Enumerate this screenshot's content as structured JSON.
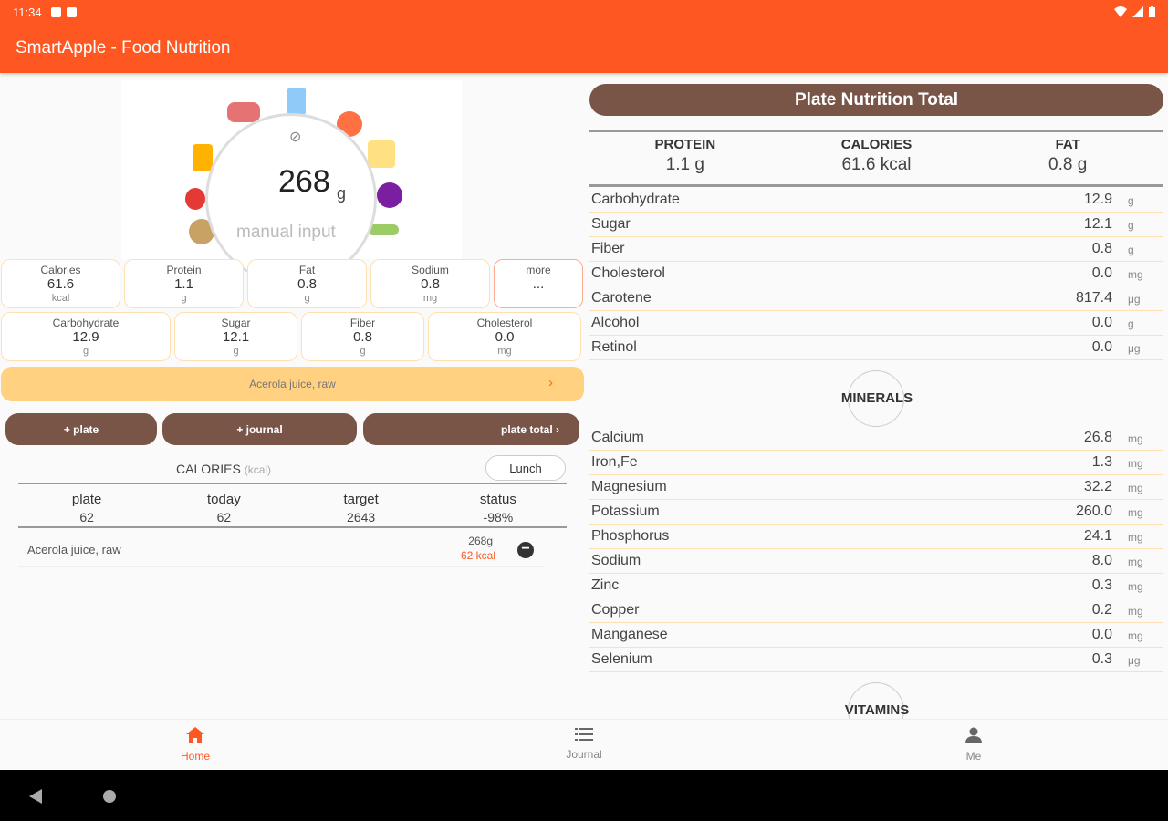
{
  "status_bar": {
    "time": "11:34"
  },
  "app": {
    "title": "SmartApple - Food Nutrition"
  },
  "plate": {
    "weight": "268",
    "weight_unit": "g",
    "manual_label": "manual input",
    "link_icon": "link-off-icon"
  },
  "nutrients_row1": [
    {
      "label": "Calories",
      "value": "61.6",
      "unit": "kcal"
    },
    {
      "label": "Protein",
      "value": "1.1",
      "unit": "g"
    },
    {
      "label": "Fat",
      "value": "0.8",
      "unit": "g"
    },
    {
      "label": "Sodium",
      "value": "0.8",
      "unit": "mg"
    },
    {
      "label": "more",
      "value": "...",
      "unit": ""
    }
  ],
  "nutrients_row2": [
    {
      "label": "Carbohydrate",
      "value": "12.9",
      "unit": "g"
    },
    {
      "label": "Sugar",
      "value": "12.1",
      "unit": "g"
    },
    {
      "label": "Fiber",
      "value": "0.8",
      "unit": "g"
    },
    {
      "label": "Cholesterol",
      "value": "0.0",
      "unit": "mg"
    }
  ],
  "food_bar": {
    "name": "Acerola juice, raw",
    "arrow": "›"
  },
  "actions": {
    "plate": "+ plate",
    "journal": "+ journal",
    "plate_total": "plate total ›"
  },
  "calories": {
    "title": "CALORIES",
    "unit": "(kcal)",
    "meal": "Lunch",
    "columns": [
      {
        "header": "plate",
        "value": "62"
      },
      {
        "header": "today",
        "value": "62"
      },
      {
        "header": "target",
        "value": "2643"
      },
      {
        "header": "status",
        "value": "-98%"
      }
    ],
    "entries": [
      {
        "name": "Acerola juice, raw",
        "weight": "268g",
        "kcal": "62 kcal"
      }
    ]
  },
  "plate_total": {
    "title": "Plate Nutrition Total",
    "macros": [
      {
        "label": "PROTEIN",
        "value": "1.1 g"
      },
      {
        "label": "CALORIES",
        "value": "61.6 kcal"
      },
      {
        "label": "FAT",
        "value": "0.8 g"
      }
    ],
    "nutrients": [
      {
        "label": "Carbohydrate",
        "value": "12.9",
        "unit": "g"
      },
      {
        "label": "Sugar",
        "value": "12.1",
        "unit": "g"
      },
      {
        "label": "Fiber",
        "value": "0.8",
        "unit": "g"
      },
      {
        "label": "Cholesterol",
        "value": "0.0",
        "unit": "mg"
      },
      {
        "label": "Carotene",
        "value": "817.4",
        "unit": "μg"
      },
      {
        "label": "Alcohol",
        "value": "0.0",
        "unit": "g"
      },
      {
        "label": "Retinol",
        "value": "0.0",
        "unit": "μg"
      }
    ],
    "minerals_title": "MINERALS",
    "minerals": [
      {
        "label": "Calcium",
        "value": "26.8",
        "unit": "mg"
      },
      {
        "label": "Iron,Fe",
        "value": "1.3",
        "unit": "mg"
      },
      {
        "label": "Magnesium",
        "value": "32.2",
        "unit": "mg"
      },
      {
        "label": "Potassium",
        "value": "260.0",
        "unit": "mg"
      },
      {
        "label": "Phosphorus",
        "value": "24.1",
        "unit": "mg"
      },
      {
        "label": "Sodium",
        "value": "8.0",
        "unit": "mg"
      },
      {
        "label": "Zinc",
        "value": "0.3",
        "unit": "mg"
      },
      {
        "label": "Copper",
        "value": "0.2",
        "unit": "mg"
      },
      {
        "label": "Manganese",
        "value": "0.0",
        "unit": "mg"
      },
      {
        "label": "Selenium",
        "value": "0.3",
        "unit": "μg"
      }
    ],
    "vitamins_title": "VITAMINS"
  },
  "bottom_nav": [
    {
      "label": "Home",
      "icon": "home-icon",
      "active": true
    },
    {
      "label": "Journal",
      "icon": "list-icon",
      "active": false
    },
    {
      "label": "Me",
      "icon": "person-icon",
      "active": false
    }
  ],
  "colors": {
    "accent": "#ff5722",
    "brown": "#795548",
    "food_bar": "#ffd180",
    "box_border": "#ffe0b2"
  }
}
